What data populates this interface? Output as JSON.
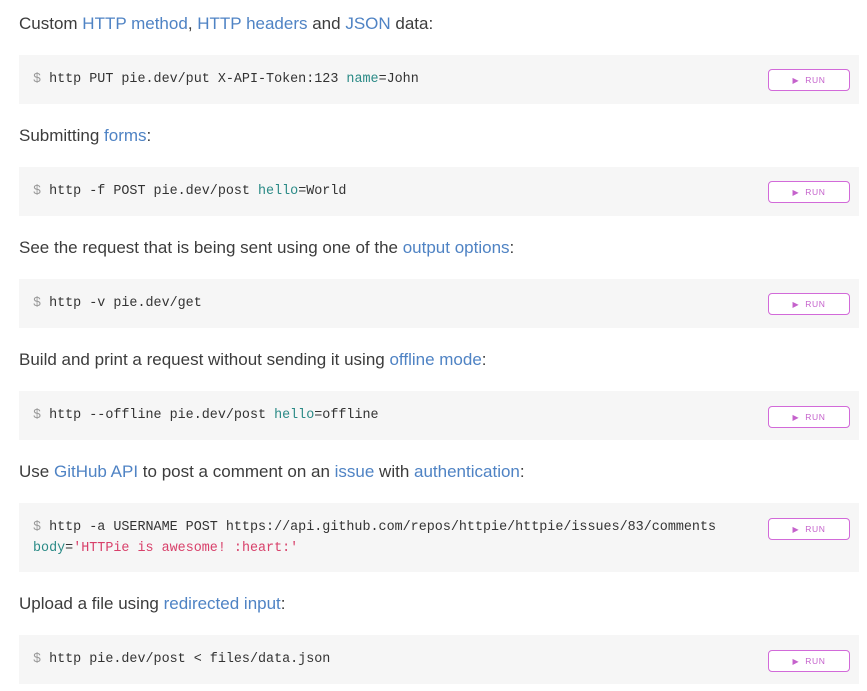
{
  "run_label": "RUN",
  "examples": [
    {
      "desc": [
        {
          "text": "Custom "
        },
        {
          "text": "HTTP method",
          "link": true
        },
        {
          "text": ", "
        },
        {
          "text": "HTTP headers",
          "link": true
        },
        {
          "text": " and "
        },
        {
          "text": "JSON",
          "link": true
        },
        {
          "text": " data:"
        }
      ],
      "lines": [
        [
          {
            "text": "$ ",
            "cls": "prompt"
          },
          {
            "text": "http PUT pie.dev/put X-API-Token:123 "
          },
          {
            "text": "name",
            "cls": "key"
          },
          {
            "text": "=John"
          }
        ]
      ]
    },
    {
      "desc": [
        {
          "text": "Submitting "
        },
        {
          "text": "forms",
          "link": true
        },
        {
          "text": ":"
        }
      ],
      "lines": [
        [
          {
            "text": "$ ",
            "cls": "prompt"
          },
          {
            "text": "http -f POST pie.dev/post "
          },
          {
            "text": "hello",
            "cls": "key"
          },
          {
            "text": "=World"
          }
        ]
      ]
    },
    {
      "desc": [
        {
          "text": "See the request that is being sent using one of the "
        },
        {
          "text": "output options",
          "link": true
        },
        {
          "text": ":"
        }
      ],
      "lines": [
        [
          {
            "text": "$ ",
            "cls": "prompt"
          },
          {
            "text": "http -v pie.dev/get"
          }
        ]
      ]
    },
    {
      "desc": [
        {
          "text": "Build and print a request without sending it using "
        },
        {
          "text": "offline mode",
          "link": true
        },
        {
          "text": ":"
        }
      ],
      "lines": [
        [
          {
            "text": "$ ",
            "cls": "prompt"
          },
          {
            "text": "http --offline pie.dev/post "
          },
          {
            "text": "hello",
            "cls": "key"
          },
          {
            "text": "=offline"
          }
        ]
      ]
    },
    {
      "desc": [
        {
          "text": "Use "
        },
        {
          "text": "GitHub API",
          "link": true
        },
        {
          "text": " to post a comment on an "
        },
        {
          "text": "issue",
          "link": true
        },
        {
          "text": " with "
        },
        {
          "text": "authentication",
          "link": true
        },
        {
          "text": ":"
        }
      ],
      "lines": [
        [
          {
            "text": "$ ",
            "cls": "prompt"
          },
          {
            "text": "http -a USERNAME POST https://api.github.com/repos/httpie/httpie/issues/83/comments"
          }
        ],
        [
          {
            "text": "body",
            "cls": "key"
          },
          {
            "text": "="
          },
          {
            "text": "'HTTPie is awesome! :heart:'",
            "cls": "str"
          }
        ]
      ]
    },
    {
      "desc": [
        {
          "text": "Upload a file using "
        },
        {
          "text": "redirected input",
          "link": true
        },
        {
          "text": ":"
        }
      ],
      "lines": [
        [
          {
            "text": "$ ",
            "cls": "prompt"
          },
          {
            "text": "http pie.dev/post < files/data.json"
          }
        ]
      ]
    }
  ]
}
